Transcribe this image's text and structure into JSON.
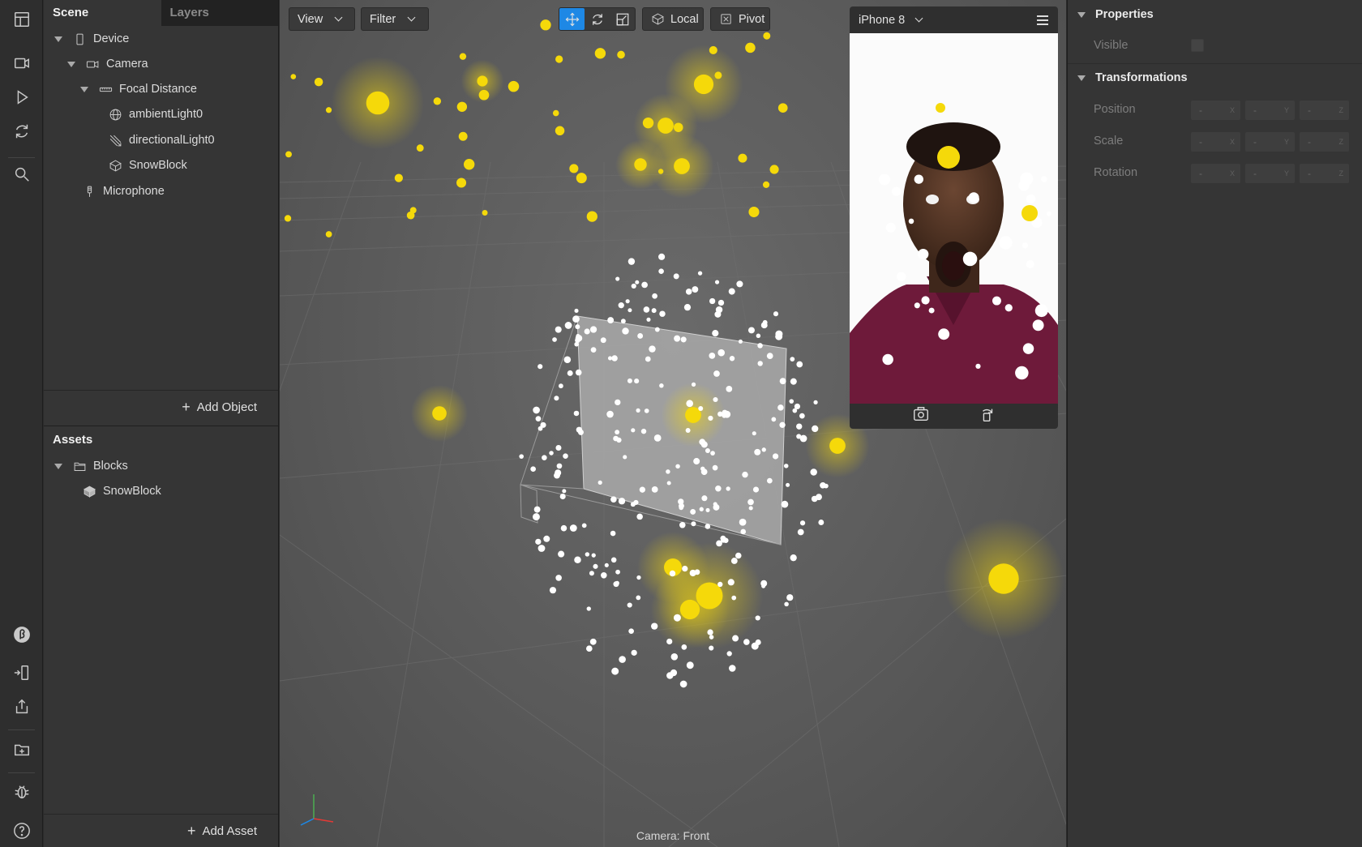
{
  "scene_panel": {
    "tabs": [
      {
        "label": "Scene"
      },
      {
        "label": "Layers"
      }
    ],
    "tree": [
      {
        "label": "Device",
        "icon": "phone-icon"
      },
      {
        "label": "Camera",
        "icon": "camera-icon"
      },
      {
        "label": "Focal Distance",
        "icon": "ruler-icon"
      },
      {
        "label": "ambientLight0",
        "icon": "globe-light-icon"
      },
      {
        "label": "directionalLight0",
        "icon": "directional-light-icon"
      },
      {
        "label": "SnowBlock",
        "icon": "block-icon"
      },
      {
        "label": "Microphone",
        "icon": "microphone-icon"
      }
    ],
    "add_object_label": "Add Object"
  },
  "assets_panel": {
    "title": "Assets",
    "tree": [
      {
        "label": "Blocks",
        "icon": "folder-icon"
      },
      {
        "label": "SnowBlock",
        "icon": "block-filled-icon"
      }
    ],
    "add_asset_label": "Add Asset"
  },
  "viewport": {
    "view_label": "View",
    "filter_label": "Filter",
    "local_label": "Local",
    "pivot_label": "Pivot",
    "camera_caption": "Camera: Front",
    "particle_color": "#f5d90a"
  },
  "preview": {
    "device": "iPhone 8"
  },
  "properties": {
    "title": "Properties",
    "visible_label": "Visible",
    "transform_title": "Transformations",
    "rows": [
      {
        "label": "Position",
        "values": [
          "-",
          "-",
          "-"
        ],
        "axes": [
          "X",
          "Y",
          "Z"
        ]
      },
      {
        "label": "Scale",
        "values": [
          "-",
          "-",
          "-"
        ],
        "axes": [
          "X",
          "Y",
          "Z"
        ]
      },
      {
        "label": "Rotation",
        "values": [
          "-",
          "-",
          "-"
        ],
        "axes": [
          "X",
          "Y",
          "Z"
        ]
      }
    ]
  },
  "toolbar_icons": [
    "layout-icon",
    "video-icon",
    "play-icon",
    "refresh-icon",
    "search-icon",
    "beta-icon",
    "device-mirror-icon",
    "share-icon",
    "add-folder-icon",
    "bug-icon",
    "help-icon"
  ]
}
